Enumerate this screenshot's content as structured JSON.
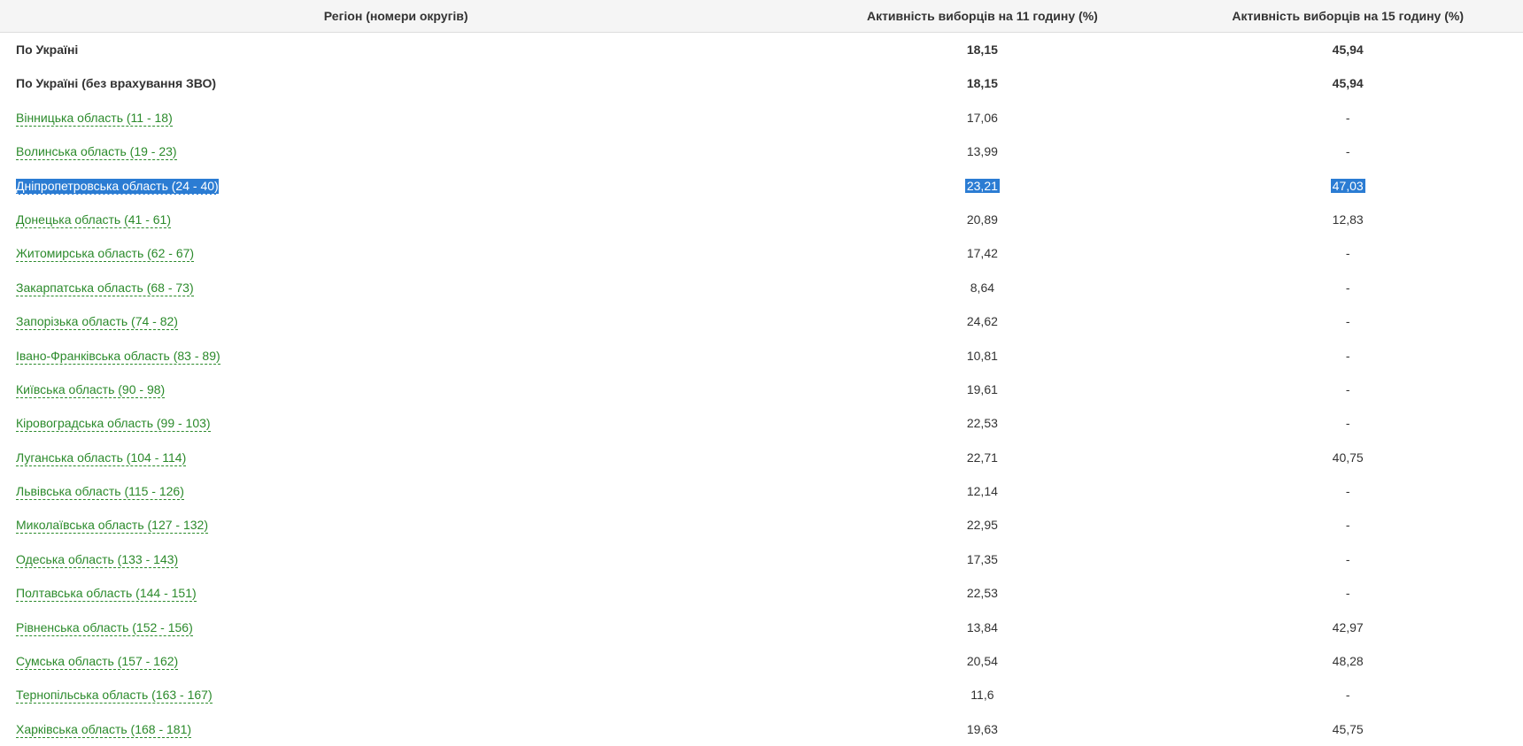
{
  "headers": {
    "region": "Регіон (номери округів)",
    "col11": "Активність виборців на 11 годину (%)",
    "col15": "Активність виборців на 15 годину (%)"
  },
  "rows": [
    {
      "label": "По Україні",
      "v11": "18,15",
      "v15": "45,94",
      "bold": true,
      "link": false,
      "selected": false
    },
    {
      "label": "По Україні (без врахування ЗВО)",
      "v11": "18,15",
      "v15": "45,94",
      "bold": true,
      "link": false,
      "selected": false
    },
    {
      "label": "Вінницька область (11 - 18)",
      "v11": "17,06",
      "v15": "-",
      "bold": false,
      "link": true,
      "selected": false
    },
    {
      "label": "Волинська область (19 - 23)",
      "v11": "13,99",
      "v15": "-",
      "bold": false,
      "link": true,
      "selected": false
    },
    {
      "label": "Дніпропетровська область (24 - 40)",
      "v11": "23,21",
      "v15": "47,03",
      "bold": false,
      "link": true,
      "selected": true
    },
    {
      "label": "Донецька область (41 - 61)",
      "v11": "20,89",
      "v15": "12,83",
      "bold": false,
      "link": true,
      "selected": false
    },
    {
      "label": "Житомирська область (62 - 67)",
      "v11": "17,42",
      "v15": "-",
      "bold": false,
      "link": true,
      "selected": false
    },
    {
      "label": "Закарпатська область (68 - 73)",
      "v11": "8,64",
      "v15": "-",
      "bold": false,
      "link": true,
      "selected": false
    },
    {
      "label": "Запорізька область (74 - 82)",
      "v11": "24,62",
      "v15": "-",
      "bold": false,
      "link": true,
      "selected": false
    },
    {
      "label": "Івано-Франківська область (83 - 89)",
      "v11": "10,81",
      "v15": "-",
      "bold": false,
      "link": true,
      "selected": false
    },
    {
      "label": "Київська область (90 - 98)",
      "v11": "19,61",
      "v15": "-",
      "bold": false,
      "link": true,
      "selected": false
    },
    {
      "label": "Кіровоградська область (99 - 103)",
      "v11": "22,53",
      "v15": "-",
      "bold": false,
      "link": true,
      "selected": false
    },
    {
      "label": "Луганська область (104 - 114)",
      "v11": "22,71",
      "v15": "40,75",
      "bold": false,
      "link": true,
      "selected": false
    },
    {
      "label": "Львівська область (115 - 126)",
      "v11": "12,14",
      "v15": "-",
      "bold": false,
      "link": true,
      "selected": false
    },
    {
      "label": "Миколаївська область (127 - 132)",
      "v11": "22,95",
      "v15": "-",
      "bold": false,
      "link": true,
      "selected": false
    },
    {
      "label": "Одеська область (133 - 143)",
      "v11": "17,35",
      "v15": "-",
      "bold": false,
      "link": true,
      "selected": false
    },
    {
      "label": "Полтавська область (144 - 151)",
      "v11": "22,53",
      "v15": "-",
      "bold": false,
      "link": true,
      "selected": false
    },
    {
      "label": "Рівненська область (152 - 156)",
      "v11": "13,84",
      "v15": "42,97",
      "bold": false,
      "link": true,
      "selected": false
    },
    {
      "label": "Сумська область (157 - 162)",
      "v11": "20,54",
      "v15": "48,28",
      "bold": false,
      "link": true,
      "selected": false
    },
    {
      "label": "Тернопільська область (163 - 167)",
      "v11": "11,6",
      "v15": "-",
      "bold": false,
      "link": true,
      "selected": false
    },
    {
      "label": "Харківська область (168 - 181)",
      "v11": "19,63",
      "v15": "45,75",
      "bold": false,
      "link": true,
      "selected": false
    }
  ]
}
